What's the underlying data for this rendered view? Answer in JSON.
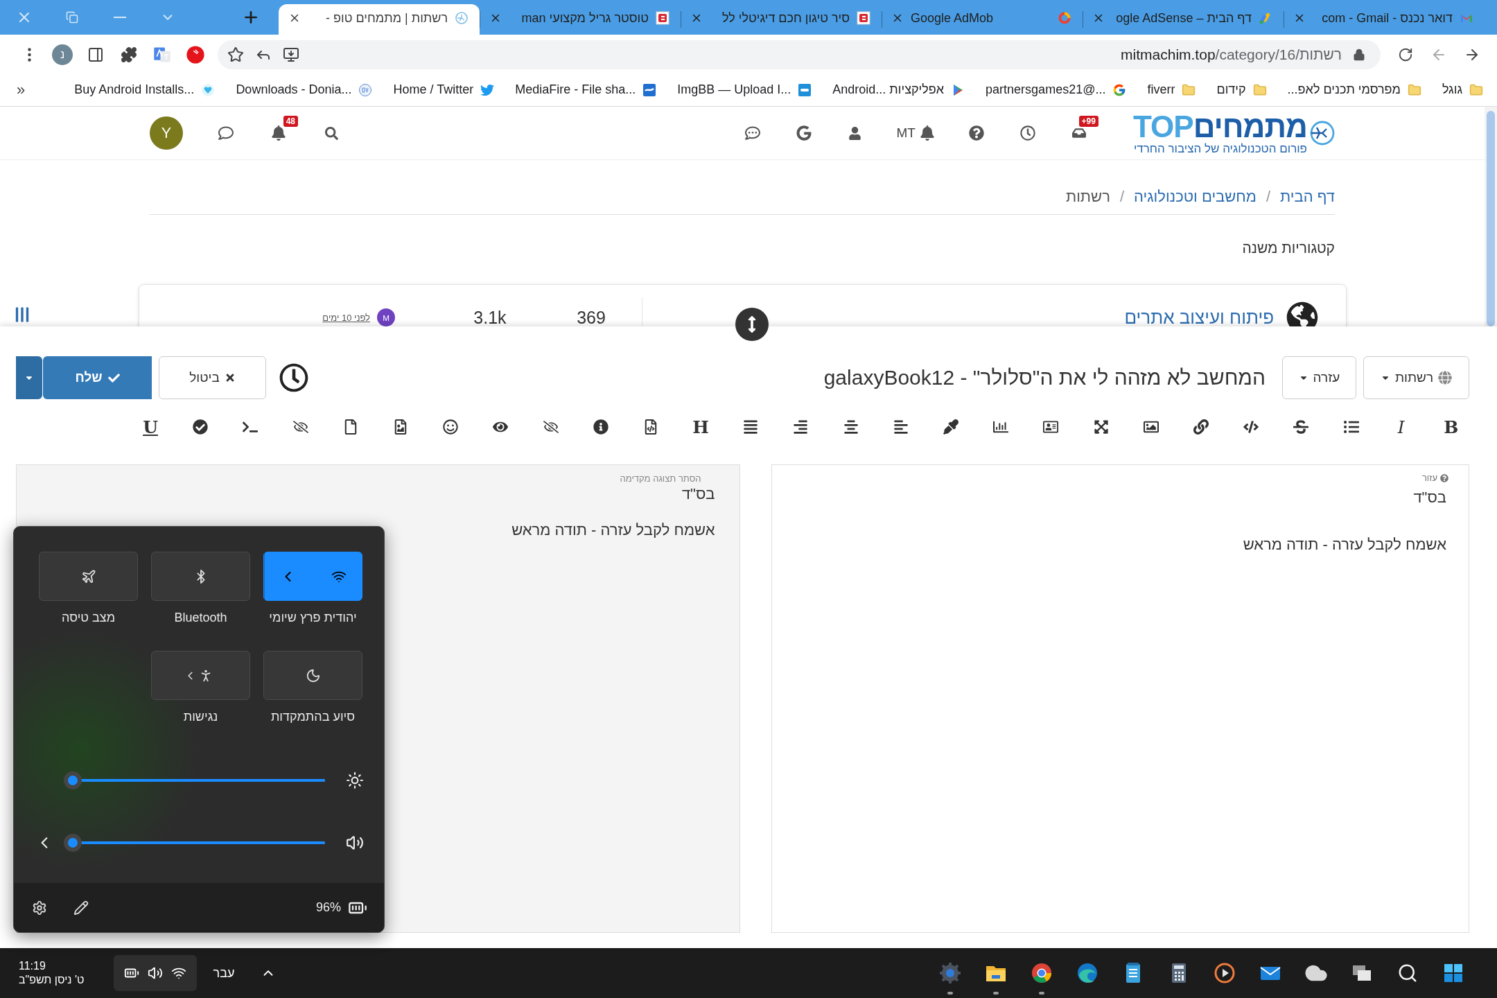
{
  "browser": {
    "tabs": [
      {
        "title": "דואר נכנס - com - Gmail",
        "selected": false
      },
      {
        "title": "דף הבית – ogle AdSense",
        "selected": false
      },
      {
        "title": "Google AdMob",
        "selected": false
      },
      {
        "title": "סיר טיגון חכם דיגיטלי לל",
        "selected": false
      },
      {
        "title": "טוסטר גריל מקצועי man",
        "selected": false
      },
      {
        "title": "רשתות | מתמחים טופ -",
        "selected": true
      }
    ],
    "url": "mitmachim.top/category/16/רשתות",
    "profile_initial": "נ",
    "bookmarks": [
      {
        "title": "גוגל"
      },
      {
        "title": "מפרסמי תכנים לאפ..."
      },
      {
        "title": "קידום"
      },
      {
        "title": "fiverr"
      },
      {
        "title": "partnersgames21@..."
      },
      {
        "title": "Android... אפליקציות"
      },
      {
        "title": "ImgBB — Upload I..."
      },
      {
        "title": "MediaFire - File sha..."
      },
      {
        "title": "Home / Twitter"
      },
      {
        "title": "Downloads - Donia..."
      },
      {
        "title": "Buy Android Installs..."
      }
    ],
    "bookmarks_more": "«"
  },
  "forum": {
    "logo": {
      "name": "מתמחים",
      "suffix": "TOP",
      "tagline": "פורום הטכנולוגיה של הציבור החרדי"
    },
    "inbox_count": "+99",
    "user_label": "MT",
    "notifications_count": "48",
    "user_initial": "Y",
    "breadcrumbs": [
      {
        "label": "דף הבית",
        "kind": "link",
        "separator": "/"
      },
      {
        "label": "מחשבים וטכנולוגיה",
        "kind": "link",
        "separator": "/"
      },
      {
        "label": "רשתות",
        "kind": "current"
      }
    ],
    "subcategories_title": "קטגוריות משנה",
    "category": {
      "title": "פיתוח ועיצוב אתרים",
      "topics": "369",
      "posts": "3.1k",
      "last_user_initial": "M",
      "last_time": "לפני 10 ימים"
    }
  },
  "composer": {
    "category": "רשתות",
    "help": "עזרה",
    "title": "המחשב לא מזהה לי את ה\"סלולר\" - galaxyBook12",
    "cancel": "ביטול",
    "submit": "שלח",
    "toolbar_letters": [
      "B",
      "I",
      "H",
      "U"
    ],
    "editor": {
      "help": "עזור",
      "lines": [
        "בס\"ד",
        "אשמח לקבל עזרה - תודה מראש"
      ]
    },
    "preview": {
      "toggle": "הסתר תצוגה מקדימה",
      "lines": [
        "בס\"ד",
        "אשמח לקבל עזרה - תודה מראש"
      ]
    }
  },
  "quick_settings": {
    "tiles": [
      {
        "kind": "wifi",
        "label": "יהודית פרץ שיומי",
        "on": true
      },
      {
        "kind": "bluetooth",
        "label": "Bluetooth",
        "on": false
      },
      {
        "kind": "airplane",
        "label": "מצב טיסה",
        "on": false
      },
      {
        "kind": "focus",
        "label": "סיוע בהתמקדות",
        "on": false
      },
      {
        "kind": "accessibility",
        "label": "נגישות",
        "on": false
      }
    ],
    "sliders": [
      {
        "kind": "brightness",
        "level": 1
      },
      {
        "kind": "volume",
        "level": 1
      }
    ],
    "battery": "96%"
  },
  "taskbar": {
    "time": "11:19",
    "date": "ט' ניסן תשפ\"ב",
    "language": "עבר",
    "apps": [
      {
        "kind": "settings",
        "running": true
      },
      {
        "kind": "files",
        "running": true
      },
      {
        "kind": "browser",
        "running": true
      },
      {
        "kind": "edge",
        "running": false
      },
      {
        "kind": "notepad",
        "running": false
      },
      {
        "kind": "calculator",
        "running": false
      },
      {
        "kind": "media",
        "running": false
      },
      {
        "kind": "mail",
        "running": false
      },
      {
        "kind": "weather",
        "running": false
      },
      {
        "kind": "taskview",
        "running": false
      },
      {
        "kind": "search",
        "running": false
      },
      {
        "kind": "start",
        "running": false
      }
    ]
  }
}
